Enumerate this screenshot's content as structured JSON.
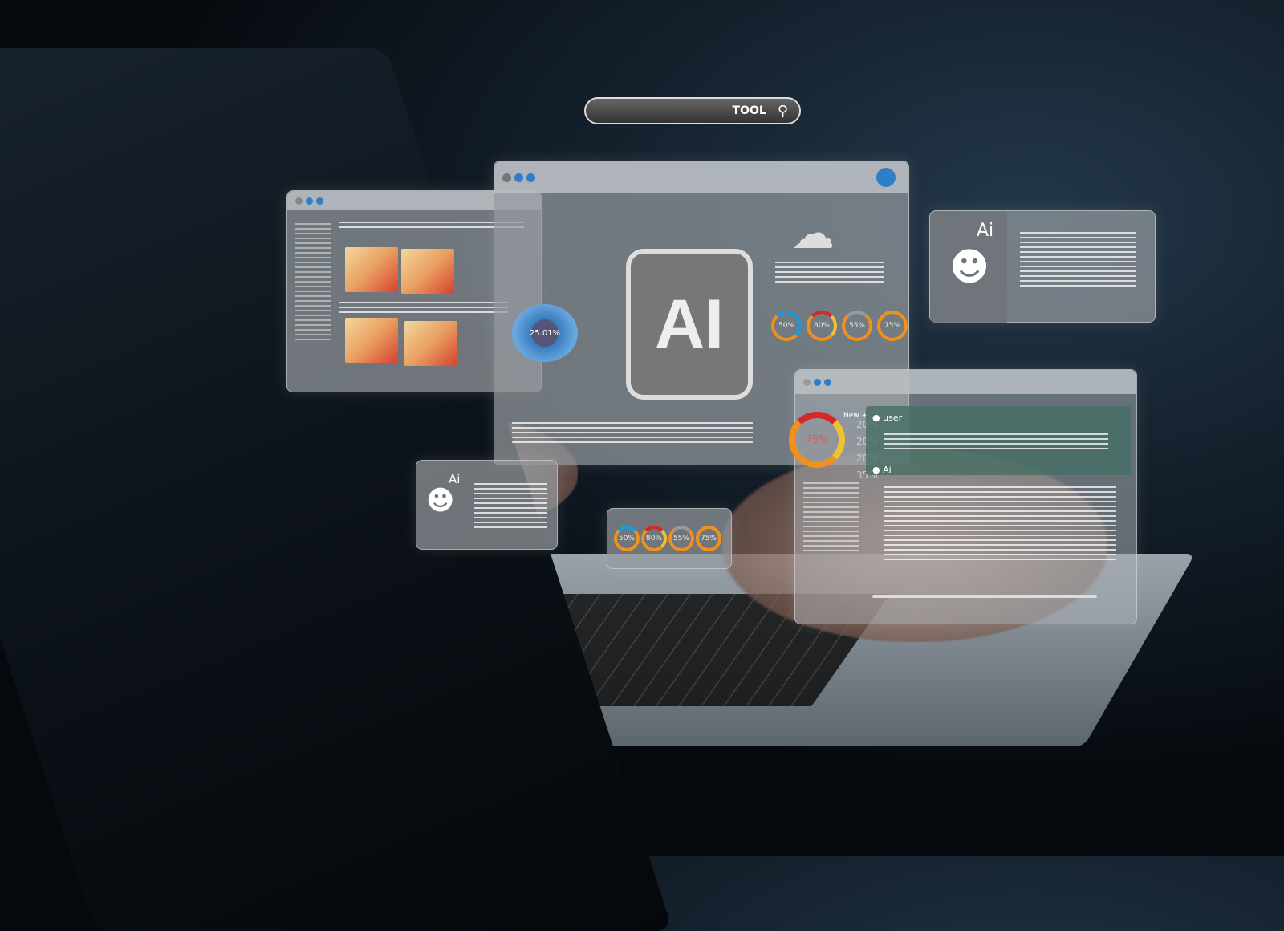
{
  "search": {
    "label": "TOOL",
    "icon": "search-icon"
  },
  "center_panel": {
    "logo": "AI",
    "stats": [
      "50%",
      "80%",
      "55%",
      "75%"
    ]
  },
  "left_panel": {
    "donut_value": "25.01%"
  },
  "bottom_widget": {
    "stats": [
      "50%",
      "80%",
      "55%",
      "75%"
    ]
  },
  "robot_card_large": {
    "label": "Ai"
  },
  "robot_card_small": {
    "label": "Ai"
  },
  "chat_panel": {
    "user_label": "user",
    "ai_label": "Ai",
    "donut_value": "75%",
    "new_label": "New +",
    "percents": [
      "20%",
      "20%",
      "20%",
      "35%"
    ]
  },
  "colors": {
    "orange": "#f0901e",
    "blue": "#1a9bd8",
    "red": "#d62828",
    "yellow": "#f2c230",
    "accent": "#2f7fc8"
  }
}
